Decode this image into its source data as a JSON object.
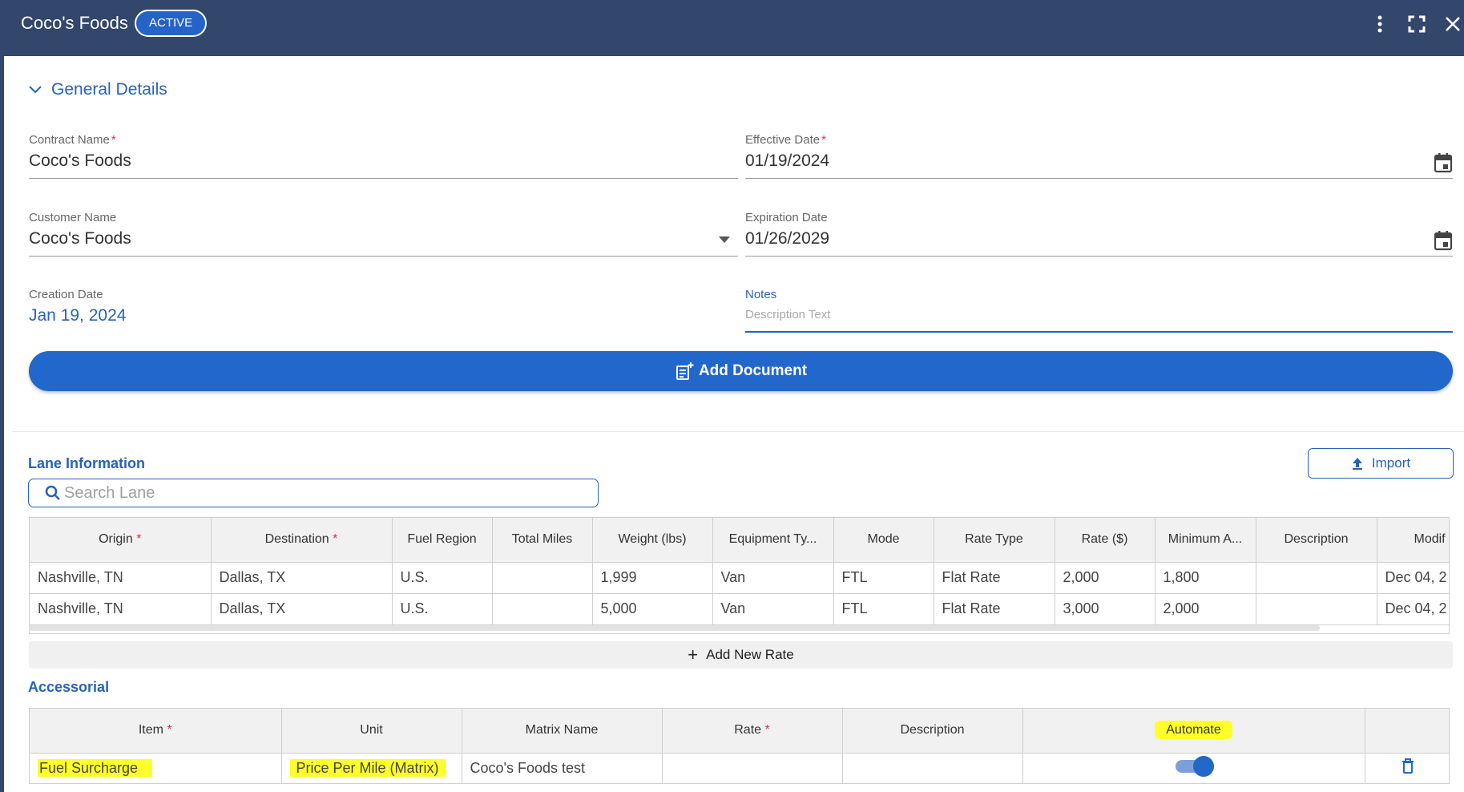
{
  "header": {
    "title": "Coco's Foods",
    "status_badge": "ACTIVE"
  },
  "general_details": {
    "section_label": "General Details",
    "contract_name": {
      "label": "Contract Name",
      "value": "Coco's Foods"
    },
    "effective_date": {
      "label": "Effective Date",
      "value": "01/19/2024"
    },
    "customer_name": {
      "label": "Customer Name",
      "value": "Coco's Foods"
    },
    "expiration_date": {
      "label": "Expiration Date",
      "value": "01/26/2029"
    },
    "creation_date": {
      "label": "Creation Date",
      "value": "Jan 19, 2024"
    },
    "notes": {
      "label": "Notes",
      "placeholder": "Description Text",
      "value": ""
    },
    "add_document_label": "Add Document"
  },
  "lane_information": {
    "title": "Lane Information",
    "import_label": "Import",
    "search_placeholder": "Search Lane",
    "columns": [
      "Origin",
      "Destination",
      "Fuel Region",
      "Total Miles",
      "Weight (lbs)",
      "Equipment Ty...",
      "Mode",
      "Rate Type",
      "Rate ($)",
      "Minimum A...",
      "Description",
      "Modif"
    ],
    "rows": [
      [
        "Nashville, TN",
        "Dallas, TX",
        "U.S.",
        "",
        "1,999",
        "Van",
        "FTL",
        "Flat Rate",
        "2,000",
        "1,800",
        "",
        "Dec 04, 2"
      ],
      [
        "Nashville, TN",
        "Dallas, TX",
        "U.S.",
        "",
        "5,000",
        "Van",
        "FTL",
        "Flat Rate",
        "3,000",
        "2,000",
        "",
        "Dec 04, 2"
      ]
    ],
    "add_rate_label": "Add New Rate"
  },
  "accessorial": {
    "title": "Accessorial",
    "columns": [
      "Item",
      "Unit",
      "Matrix Name",
      "Rate",
      "Description",
      "Automate",
      ""
    ],
    "rows": [
      {
        "item": "Fuel Surcharge",
        "unit": "Price Per Mile (Matrix)",
        "matrix_name": "Coco's Foods test",
        "rate": "",
        "description": "",
        "automate": true
      }
    ]
  },
  "colors": {
    "header_bg": "#33466b",
    "accent": "#2167cc",
    "required": "#d9304c",
    "highlight": "#ffff2a"
  },
  "icons": [
    "more-vertical-icon",
    "fullscreen-icon",
    "close-icon",
    "chevron-down-icon",
    "calendar-icon",
    "dropdown-caret-icon",
    "document-add-icon",
    "upload-icon",
    "search-icon",
    "plus-icon",
    "trash-icon"
  ]
}
